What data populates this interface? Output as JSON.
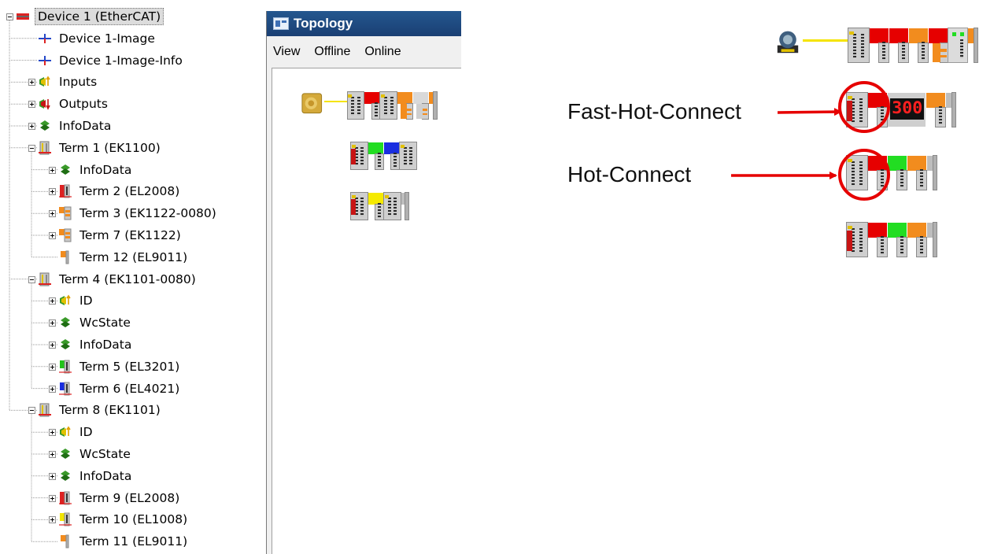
{
  "tree": {
    "items": [
      {
        "label": "Device 1 (EtherCAT)",
        "icon": "ethercat-device-icon",
        "level": 0,
        "expander": "minus",
        "selected": true
      },
      {
        "label": "Device 1-Image",
        "icon": "process-image-icon",
        "level": 1,
        "expander": "none"
      },
      {
        "label": "Device 1-Image-Info",
        "icon": "process-image-icon",
        "level": 1,
        "expander": "none"
      },
      {
        "label": "Inputs",
        "icon": "inputs-icon",
        "level": 1,
        "expander": "plus"
      },
      {
        "label": "Outputs",
        "icon": "outputs-icon",
        "level": 1,
        "expander": "plus"
      },
      {
        "label": "InfoData",
        "icon": "infodata-icon",
        "level": 1,
        "expander": "plus"
      },
      {
        "label": "Term 1 (EK1100)",
        "icon": "coupler-icon",
        "level": 1,
        "expander": "minus"
      },
      {
        "label": "InfoData",
        "icon": "infodata-icon",
        "level": 2,
        "expander": "plus"
      },
      {
        "label": "Term 2 (EL2008)",
        "icon": "digital-output-terminal-icon",
        "level": 2,
        "expander": "plus"
      },
      {
        "label": "Term 3 (EK1122-0080)",
        "icon": "junction-terminal-icon",
        "level": 2,
        "expander": "plus"
      },
      {
        "label": "Term 7 (EK1122)",
        "icon": "junction-terminal-icon",
        "level": 2,
        "expander": "plus"
      },
      {
        "label": "Term 12 (EL9011)",
        "icon": "end-terminal-icon",
        "level": 2,
        "expander": "none"
      },
      {
        "label": "Term 4 (EK1101-0080)",
        "icon": "coupler-icon",
        "level": 1,
        "expander": "minus"
      },
      {
        "label": "ID",
        "icon": "inputs-icon",
        "level": 2,
        "expander": "plus"
      },
      {
        "label": "WcState",
        "icon": "infodata-icon",
        "level": 2,
        "expander": "plus"
      },
      {
        "label": "InfoData",
        "icon": "infodata-icon",
        "level": 2,
        "expander": "plus"
      },
      {
        "label": "Term 5 (EL3201)",
        "icon": "analog-input-terminal-icon",
        "level": 2,
        "expander": "plus"
      },
      {
        "label": "Term 6 (EL4021)",
        "icon": "analog-output-terminal-icon",
        "level": 2,
        "expander": "plus"
      },
      {
        "label": "Term 8 (EK1101)",
        "icon": "coupler-icon",
        "level": 1,
        "expander": "minus"
      },
      {
        "label": "ID",
        "icon": "inputs-icon",
        "level": 2,
        "expander": "plus"
      },
      {
        "label": "WcState",
        "icon": "infodata-icon",
        "level": 2,
        "expander": "plus"
      },
      {
        "label": "InfoData",
        "icon": "infodata-icon",
        "level": 2,
        "expander": "plus"
      },
      {
        "label": "Term 9 (EL2008)",
        "icon": "digital-output-terminal-icon",
        "level": 2,
        "expander": "plus"
      },
      {
        "label": "Term 10 (EL1008)",
        "icon": "digital-input-terminal-icon",
        "level": 2,
        "expander": "plus"
      },
      {
        "label": "Term 11 (EL9011)",
        "icon": "end-terminal-icon",
        "level": 2,
        "expander": "none"
      }
    ]
  },
  "topology": {
    "title": "Topology",
    "title_icon": "topology-window-icon",
    "menu": [
      "View",
      "Offline",
      "Online"
    ],
    "rows": [
      [
        "master-icon",
        "coupler",
        "red",
        "coupler",
        "orange-junction",
        "gray-junction",
        "end-orange"
      ],
      [
        "coupler-red",
        "green",
        "blue",
        "coupler-gray"
      ],
      [
        "coupler-red",
        "yellow",
        "coupler-gray",
        "end-gray"
      ]
    ]
  },
  "diagram": {
    "rows": [
      [
        "master-icon",
        "coupler",
        "red",
        "red",
        "orange",
        "junction-red",
        "gray-light",
        "end-orange-gray"
      ],
      [
        "coupler-red-highlight",
        "red",
        "display-300",
        "orange",
        "end-gray"
      ],
      [
        "coupler",
        "red",
        "green",
        "orange",
        "end-gray"
      ],
      [
        "coupler-red",
        "red",
        "green",
        "orange",
        "end-gray"
      ]
    ],
    "display_value": "300",
    "labels": {
      "fast_hot_connect": "Fast-Hot-Connect",
      "hot_connect": "Hot-Connect"
    },
    "accent_red": "#e60000",
    "link_yellow": "#f5e400"
  }
}
